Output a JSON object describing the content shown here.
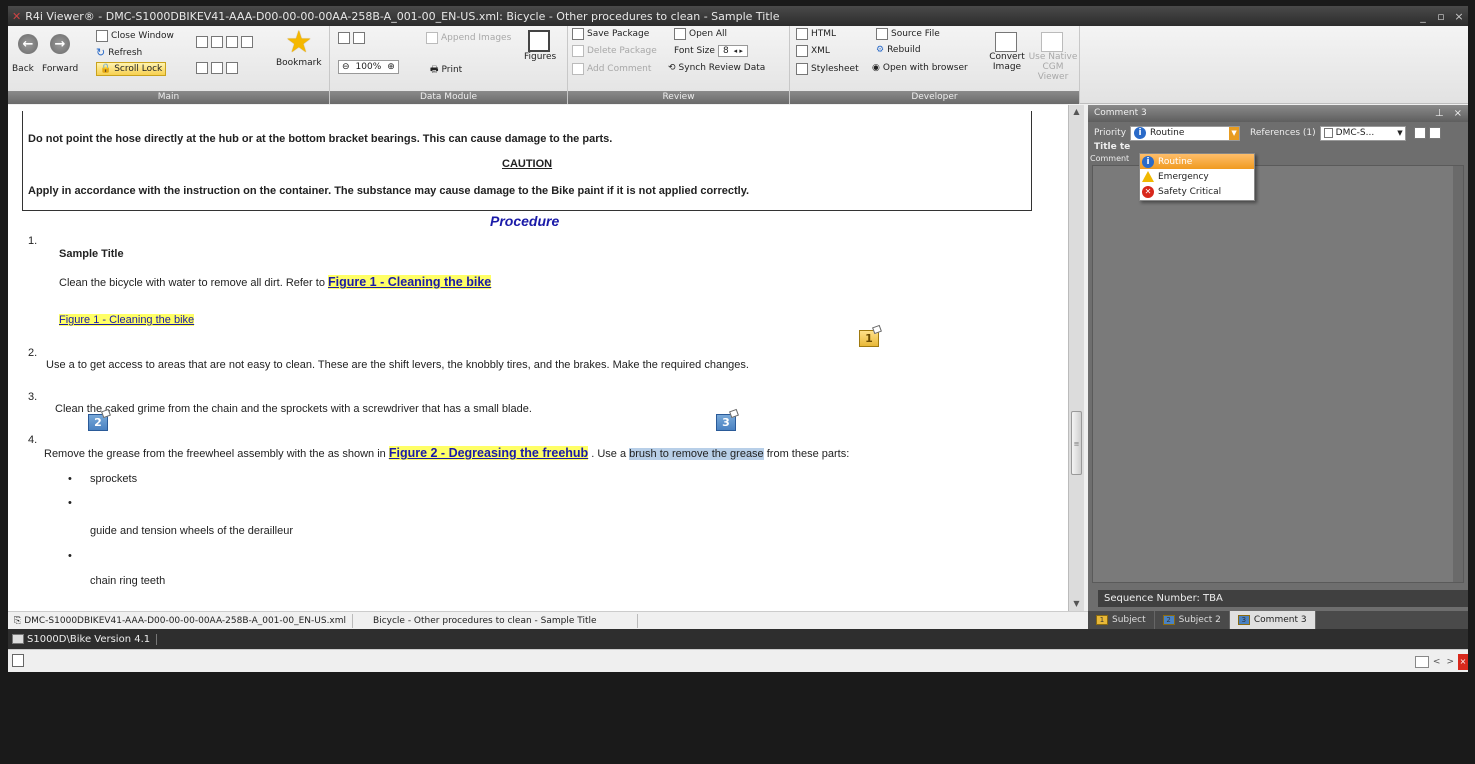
{
  "window": {
    "title": "R4i Viewer® - DMC-S1000DBIKEV41-AAA-D00-00-00-00AA-258B-A_001-00_EN-US.xml: Bicycle - Other procedures to clean - Sample Title",
    "minimize": "_",
    "restore": "▫",
    "close": "×"
  },
  "ribbon": {
    "main": {
      "label": "Main",
      "back": "Back",
      "forward": "Forward",
      "close_window": "Close Window",
      "refresh": "Refresh",
      "scroll_lock": "Scroll Lock",
      "bookmark": "Bookmark"
    },
    "data_module": {
      "label": "Data Module",
      "append_images": "Append Images",
      "zoom": "100%",
      "print": "Print",
      "figures": "Figures"
    },
    "review": {
      "label": "Review",
      "save_package": "Save Package",
      "delete_package": "Delete Package",
      "add_comment": "Add Comment",
      "open_all": "Open All",
      "font_size_label": "Font Size",
      "font_size_value": "8",
      "synch_review_data": "Synch Review Data"
    },
    "developer": {
      "label": "Developer",
      "html": "HTML",
      "xml": "XML",
      "stylesheet": "Stylesheet",
      "source_file": "Source File",
      "rebuild": "Rebuild",
      "open_with_browser": "Open with browser",
      "convert_image": "Convert Image",
      "use_native_cgm": "Use Native CGM Viewer"
    }
  },
  "document": {
    "warning_text": "Do not point the hose directly at the hub or at the bottom bracket bearings. This can cause damage to the parts.",
    "caution_heading": "CAUTION",
    "caution_text": "Apply in accordance with the instruction on the container. The substance may cause damage to the Bike paint if it is not applied correctly.",
    "procedure_heading": "Procedure",
    "step1_num": "1.",
    "step1_title": "Sample Title",
    "step1_text_pre": "Clean the bicycle with water to remove all dirt. Refer to ",
    "step1_link": "Figure 1 - Cleaning the bike",
    "figure1_caption": "Figure 1 - Cleaning the bike",
    "step2_num": "2.",
    "step2_text": "Use a to get access to areas that are not easy to clean. These are the shift levers, the knobbly tires, and the brakes. Make the required changes.",
    "step3_num": "3.",
    "step3_text": "Clean the caked grime from the chain and the sprockets with a screwdriver that has a small blade.",
    "step4_num": "4.",
    "step4_text_pre": "Remove the grease from the freewheel assembly with the as shown in ",
    "step4_link": "Figure 2 - Degreasing the freehub",
    "step4_text_mid": " . Use a ",
    "step4_highlight": "brush to remove the grease",
    "step4_text_post": " from these parts:",
    "list_item1": "sprockets",
    "list_item2": "guide and tension wheels of the derailleur",
    "list_item3": "chain ring teeth",
    "bullet": "•",
    "markers": [
      "1",
      "2",
      "3"
    ]
  },
  "comment_pane": {
    "title": "Comment 3",
    "priority_label": "Priority",
    "priority_value": "Routine",
    "references_label": "References (1)",
    "references_value": "DMC-S...",
    "title_field_label": "Title te",
    "comment_field_label": "Comment",
    "priority_options": [
      "Routine",
      "Emergency",
      "Safety Critical"
    ],
    "sequence_number": "Sequence Number: TBA",
    "tabs": [
      "Subject",
      "Subject 2",
      "Comment 3"
    ]
  },
  "status": {
    "filename": "DMC-S1000DBIKEV41-AAA-D00-00-00-00AA-258B-A_001-00_EN-US.xml",
    "doc_title": "Bicycle - Other procedures to clean - Sample Title",
    "path": "S1000D\\Bike Version 4.1"
  },
  "colors": {
    "link_blue": "#1a1aa8",
    "highlight_yellow": "#ffff66",
    "selection_orange": "#f09a20",
    "title_bar": "#2c2c2c"
  }
}
